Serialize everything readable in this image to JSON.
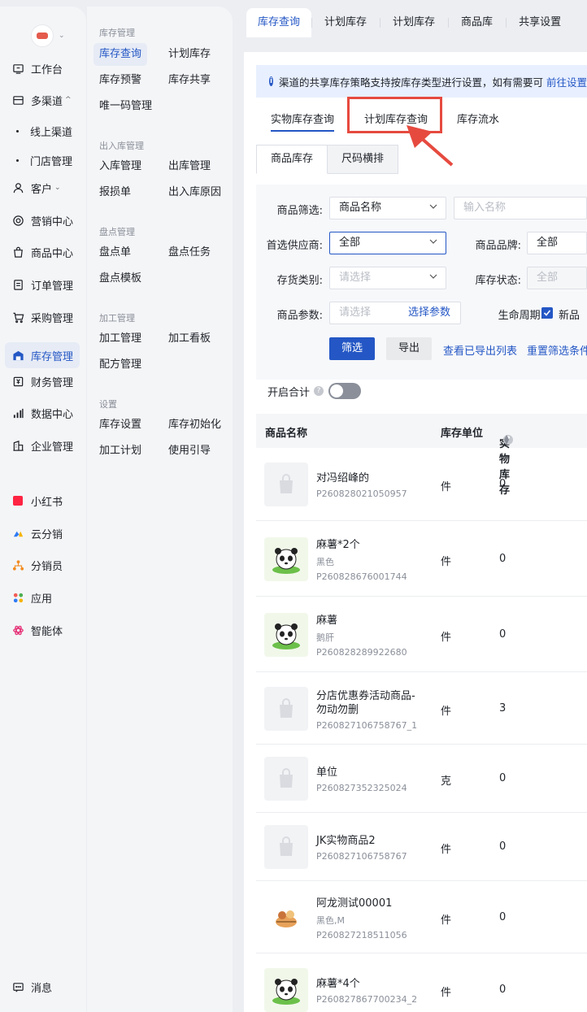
{
  "nav": {
    "items": [
      {
        "label": "工作台",
        "icon": "workbench-icon"
      },
      {
        "label": "多渠道",
        "icon": "store-icon"
      },
      {
        "label": "线上渠道"
      },
      {
        "label": "门店管理"
      },
      {
        "label": "客户",
        "icon": "user-icon"
      },
      {
        "label": "营销中心",
        "icon": "target-icon"
      },
      {
        "label": "商品中心",
        "icon": "bag-icon"
      },
      {
        "label": "订单管理",
        "icon": "order-icon"
      },
      {
        "label": "采购管理",
        "icon": "cart-icon"
      },
      {
        "label": "库存管理",
        "icon": "warehouse-icon"
      },
      {
        "label": "财务管理",
        "icon": "finance-icon"
      },
      {
        "label": "数据中心",
        "icon": "chart-icon"
      },
      {
        "label": "企业管理",
        "icon": "company-icon"
      }
    ],
    "apps": [
      {
        "label": "小红书",
        "color": "#ff2442"
      },
      {
        "label": "云分销",
        "color": "#2f7bf5"
      },
      {
        "label": "分销员",
        "color": "#f28a1e"
      },
      {
        "label": "应用",
        "color": "#4caf50"
      },
      {
        "label": "智能体",
        "color": "#e6367a"
      }
    ],
    "messages": "消息"
  },
  "subnav": {
    "groups": [
      {
        "title": "库存管理",
        "items": [
          "库存查询",
          "计划库存",
          "库存预警",
          "库存共享",
          "唯一码管理"
        ]
      },
      {
        "title": "出入库管理",
        "items": [
          "入库管理",
          "出库管理",
          "报损单",
          "出入库原因"
        ]
      },
      {
        "title": "盘点管理",
        "items": [
          "盘点单",
          "盘点任务",
          "盘点模板"
        ]
      },
      {
        "title": "加工管理",
        "items": [
          "加工管理",
          "加工看板",
          "配方管理"
        ]
      },
      {
        "title": "设置",
        "items": [
          "库存设置",
          "库存初始化",
          "加工计划",
          "使用引导"
        ]
      }
    ]
  },
  "toptabs": [
    "库存查询",
    "计划库存",
    "计划库存",
    "商品库",
    "共享设置"
  ],
  "notice": {
    "text": "渠道的共享库存策略支持按库存类型进行设置，如有需要可",
    "link": "前往设置"
  },
  "subtabs": [
    "实物库存查询",
    "计划库存查询",
    "库存流水"
  ],
  "seg": [
    "商品库存",
    "尺码横排"
  ],
  "filter": {
    "product_filter_label": "商品筛选:",
    "product_filter_value": "商品名称",
    "name_placeholder": "输入名称",
    "supplier_label": "首选供应商:",
    "supplier_value": "全部",
    "brand_label": "商品品牌:",
    "brand_value": "全部",
    "stock_type_label": "存货类别:",
    "stock_type_placeholder": "请选择",
    "stock_status_label": "库存状态:",
    "stock_status_value": "全部",
    "param_label": "商品参数:",
    "param_placeholder": "请选择",
    "param_link": "选择参数",
    "lifecycle_label": "生命周期:",
    "lifecycle_option": "新品",
    "filter_btn": "筛选",
    "export_btn": "导出",
    "export_list_link": "查看已导出列表",
    "reset_link": "重置筛选条件"
  },
  "summary_label": "开启合计",
  "table": {
    "headers": [
      "商品名称",
      "库存单位",
      "实物库存"
    ],
    "rows": [
      {
        "name": "对冯绍峰的",
        "spec": "",
        "code": "P260828021050957",
        "unit": "件",
        "stock": "0",
        "thumb": "placeholder"
      },
      {
        "name": "麻薯*2个",
        "spec": "黑色",
        "code": "P260828676001744",
        "unit": "件",
        "stock": "0",
        "thumb": "panda"
      },
      {
        "name": "麻薯",
        "spec": "鹅肝",
        "code": "P260828289922680",
        "unit": "件",
        "stock": "0",
        "thumb": "panda"
      },
      {
        "name": "分店优惠券活动商品-勿动勿删",
        "spec": "",
        "code": "P260827106758767_1",
        "unit": "件",
        "stock": "3",
        "thumb": "placeholder"
      },
      {
        "name": "单位",
        "spec": "",
        "code": "P260827352325024",
        "unit": "克",
        "stock": "0",
        "thumb": "placeholder"
      },
      {
        "name": "JK实物商品2",
        "spec": "",
        "code": "P260827106758767",
        "unit": "件",
        "stock": "0",
        "thumb": "placeholder"
      },
      {
        "name": "阿龙测试00001",
        "spec": "黑色,M",
        "code": "P260827218511056",
        "unit": "件",
        "stock": "0",
        "thumb": "food"
      },
      {
        "name": "麻薯*4个",
        "spec": "",
        "code": "P260827867700234_2",
        "unit": "件",
        "stock": "0",
        "thumb": "panda"
      }
    ]
  }
}
